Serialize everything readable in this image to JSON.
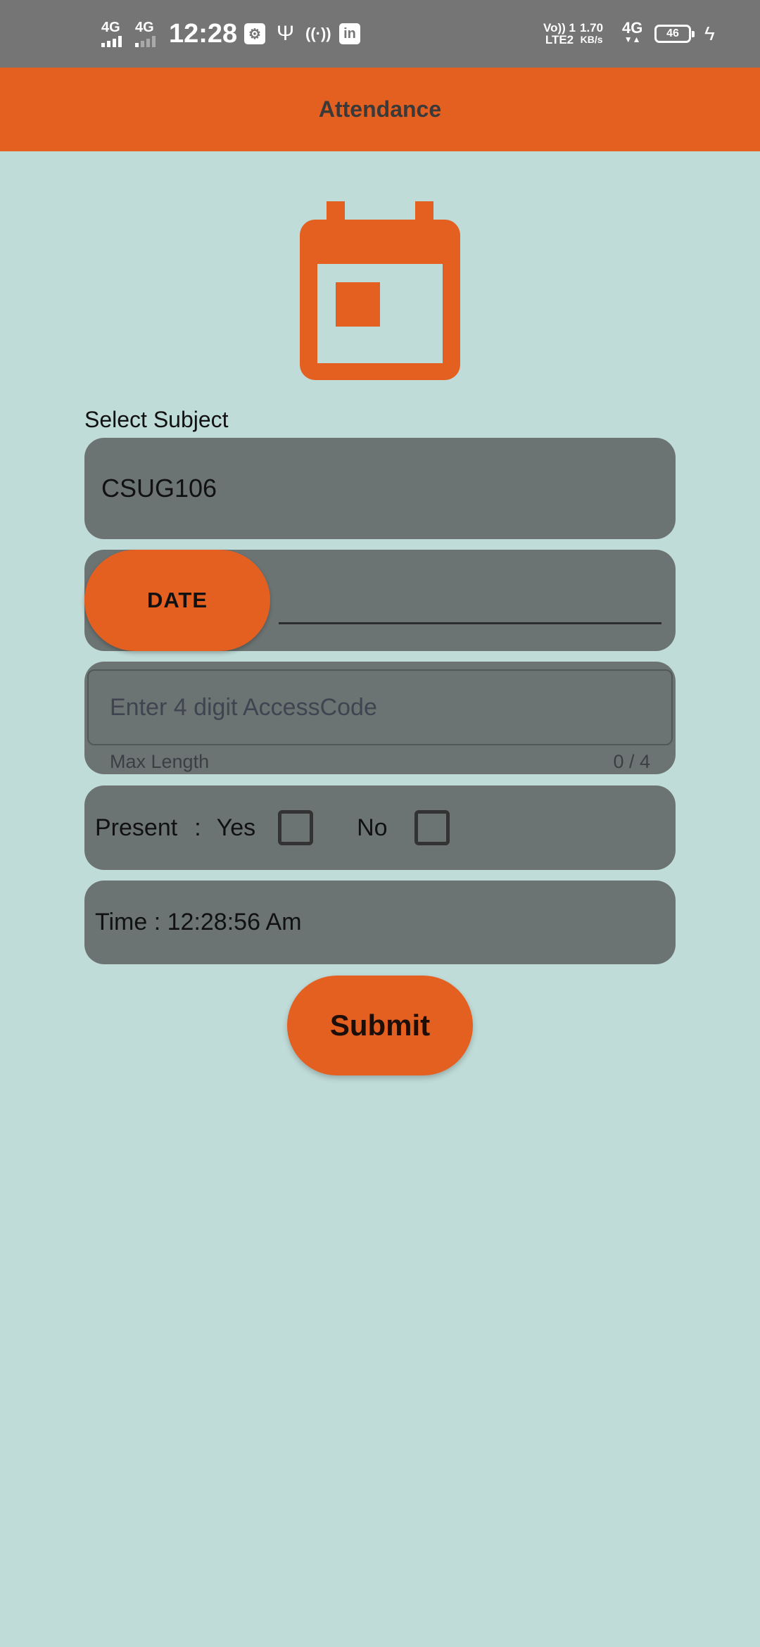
{
  "status_bar": {
    "network1": "4G",
    "network2": "4G",
    "time": "12:28",
    "volte_line1": "Vo)) 1",
    "volte_line2": "LTE2",
    "speed_value": "1.70",
    "speed_unit": "KB/s",
    "network3": "4G",
    "battery_level": "46"
  },
  "app_bar": {
    "title": "Attendance"
  },
  "colors": {
    "accent": "#e46021",
    "background": "#c0dcd8",
    "card": "#6c7473"
  },
  "form": {
    "subject_label": "Select Subject",
    "subject_value": "CSUG106",
    "date_button": "DATE",
    "access_code": {
      "placeholder": "Enter 4 digit AccessCode",
      "value": "",
      "helper_text": "Max Length",
      "counter": "0 / 4"
    },
    "present": {
      "label": "Present",
      "separator": ":",
      "yes_label": "Yes",
      "no_label": "No",
      "yes_checked": false,
      "no_checked": false
    },
    "time_text": "Time : 12:28:56 Am",
    "submit_label": "Submit"
  }
}
